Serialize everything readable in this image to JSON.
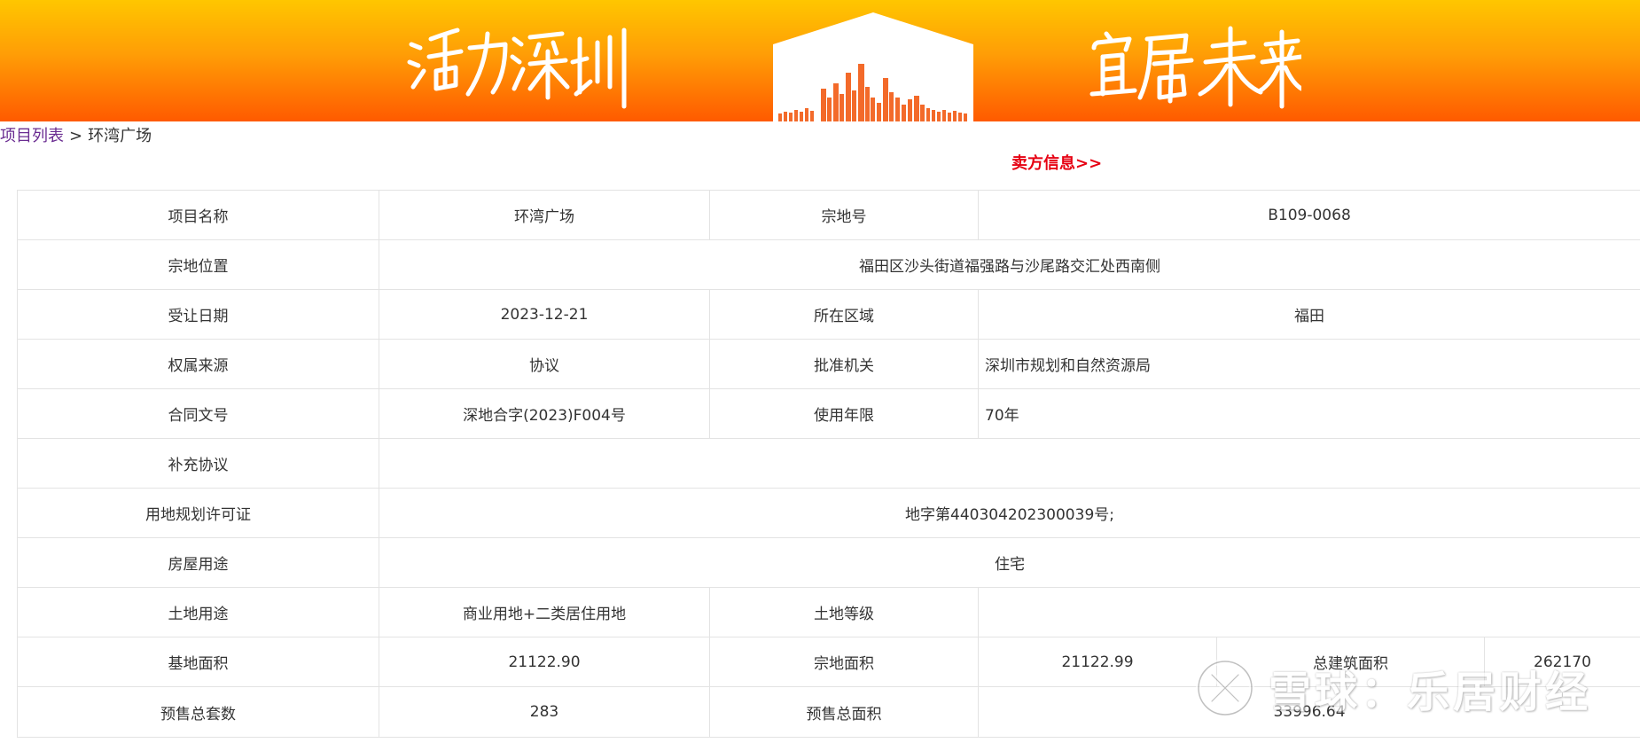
{
  "banner": {
    "slogan_left": "活力深圳",
    "slogan_right": "宜居未来"
  },
  "breadcrumb": {
    "link_label": "项目列表",
    "separator": ">",
    "current": "环湾广场"
  },
  "seller_link": "卖方信息>>",
  "details": {
    "project_name_label": "项目名称",
    "project_name": "环湾广场",
    "parcel_no_label": "宗地号",
    "parcel_no": "B109-0068",
    "parcel_location_label": "宗地位置",
    "parcel_location": "福田区沙头街道福强路与沙尾路交汇处西南侧",
    "transfer_date_label": "受让日期",
    "transfer_date": "2023-12-21",
    "district_label": "所在区域",
    "district": "福田",
    "ownership_source_label": "权属来源",
    "ownership_source": "协议",
    "approval_authority_label": "批准机关",
    "approval_authority": "深圳市规划和自然资源局",
    "contract_no_label": "合同文号",
    "contract_no": "深地合字(2023)F004号",
    "usage_term_label": "使用年限",
    "usage_term": "70年",
    "supplementary_label": "补充协议",
    "supplementary": "",
    "land_permit_label": "用地规划许可证",
    "land_permit": "地字第440304202300039号;",
    "house_use_label": "房屋用途",
    "house_use": "住宅",
    "land_use_label": "土地用途",
    "land_use": "商业用地+二类居住用地",
    "land_grade_label": "土地等级",
    "land_grade": "",
    "base_area_label": "基地面积",
    "base_area": "21122.90",
    "parcel_area_label": "宗地面积",
    "parcel_area": "21122.99",
    "total_floor_area_label": "总建筑面积",
    "total_floor_area": "262170",
    "presale_units_label": "预售总套数",
    "presale_units": "283",
    "presale_area_label": "预售总面积",
    "presale_area": "33996.64"
  },
  "watermark": {
    "text": "雪球：乐居财经"
  }
}
